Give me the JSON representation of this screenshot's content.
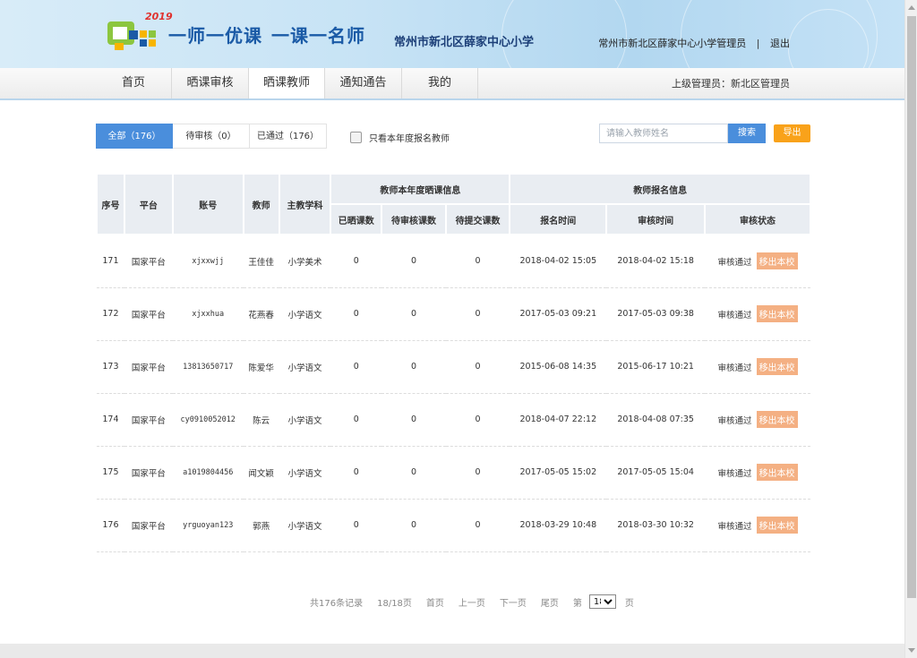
{
  "header": {
    "logo_year": "2019",
    "slogan_part1": "一师一优课",
    "slogan_part2": "一课一名师",
    "school_name": "常州市新北区薛家中心小学",
    "user_label": "常州市新北区薛家中心小学管理员",
    "separator": "|",
    "logout_label": "退出"
  },
  "nav": {
    "items": [
      {
        "label": "首页"
      },
      {
        "label": "晒课审核"
      },
      {
        "label": "晒课教师"
      },
      {
        "label": "通知通告"
      },
      {
        "label": "我的"
      }
    ],
    "active_index": 2,
    "superior_admin": "上级管理员：新北区管理员"
  },
  "filters": {
    "tabs": [
      {
        "label": "全部（176）"
      },
      {
        "label": "待审核（0）"
      },
      {
        "label": "已通过（176）"
      }
    ],
    "active_index": 0,
    "only_this_year_label": "只看本年度报名教师",
    "search_placeholder": "请输入教师姓名",
    "search_label": "搜索",
    "export_label": "导出"
  },
  "table": {
    "headers": {
      "index": "序号",
      "platform": "平台",
      "account": "账号",
      "teacher": "教师",
      "subject": "主教学科",
      "group_annual": "教师本年度晒课信息",
      "group_registration": "教师报名信息",
      "posted": "已晒课数",
      "pending_review": "待审核课数",
      "pending_submit": "待提交课数",
      "register_time": "报名时间",
      "review_time": "审核时间",
      "review_status": "审核状态"
    },
    "remove_label": "移出本校",
    "rows": [
      {
        "index": "171",
        "platform": "国家平台",
        "account": "xjxxwjj",
        "teacher": "王佳佳",
        "subject": "小学美术",
        "posted": "0",
        "pending_review": "0",
        "pending_submit": "0",
        "register_time": "2018-04-02 15:05",
        "review_time": "2018-04-02 15:18",
        "status": "审核通过"
      },
      {
        "index": "172",
        "platform": "国家平台",
        "account": "xjxxhua",
        "teacher": "花燕春",
        "subject": "小学语文",
        "posted": "0",
        "pending_review": "0",
        "pending_submit": "0",
        "register_time": "2017-05-03 09:21",
        "review_time": "2017-05-03 09:38",
        "status": "审核通过"
      },
      {
        "index": "173",
        "platform": "国家平台",
        "account": "13813650717",
        "teacher": "陈爱华",
        "subject": "小学语文",
        "posted": "0",
        "pending_review": "0",
        "pending_submit": "0",
        "register_time": "2015-06-08 14:35",
        "review_time": "2015-06-17 10:21",
        "status": "审核通过"
      },
      {
        "index": "174",
        "platform": "国家平台",
        "account": "cy0910052012",
        "teacher": "陈云",
        "subject": "小学语文",
        "posted": "0",
        "pending_review": "0",
        "pending_submit": "0",
        "register_time": "2018-04-07 22:12",
        "review_time": "2018-04-08 07:35",
        "status": "审核通过"
      },
      {
        "index": "175",
        "platform": "国家平台",
        "account": "a1019804456",
        "teacher": "闻文颖",
        "subject": "小学语文",
        "posted": "0",
        "pending_review": "0",
        "pending_submit": "0",
        "register_time": "2017-05-05 15:02",
        "review_time": "2017-05-05 15:04",
        "status": "审核通过"
      },
      {
        "index": "176",
        "platform": "国家平台",
        "account": "yrguoyan123",
        "teacher": "郭燕",
        "subject": "小学语文",
        "posted": "0",
        "pending_review": "0",
        "pending_submit": "0",
        "register_time": "2018-03-29 10:48",
        "review_time": "2018-03-30 10:32",
        "status": "审核通过"
      }
    ]
  },
  "pagination": {
    "total": "共176条记录",
    "page_of": "18/18页",
    "first": "首页",
    "prev": "上一页",
    "next": "下一页",
    "last": "尾页",
    "go_prefix": "第",
    "current_page": "18",
    "go_suffix": "页"
  },
  "colors": {
    "accent_blue": "#4a8edc",
    "export_orange": "#f9a21a",
    "remove_orange": "#f4b083"
  }
}
